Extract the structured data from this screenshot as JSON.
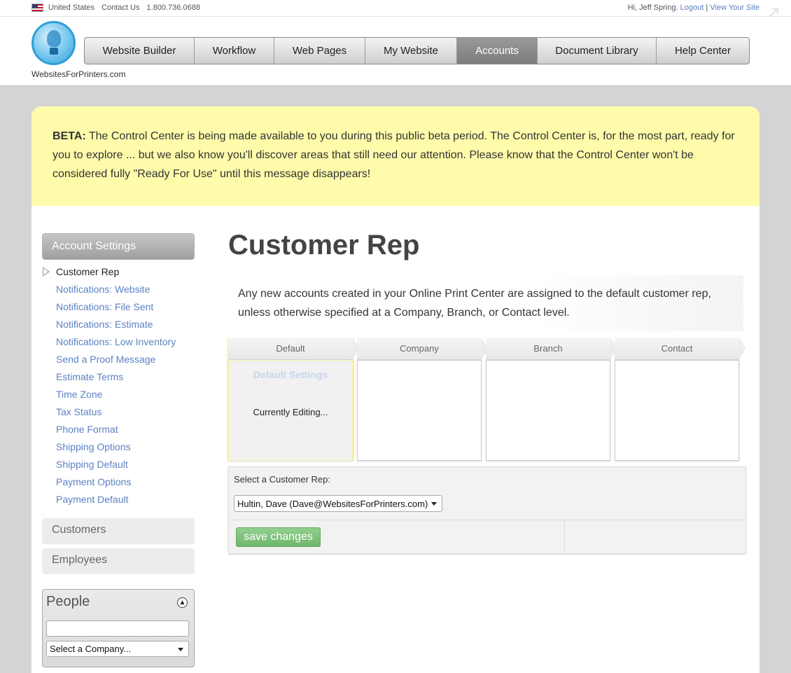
{
  "topbar": {
    "country": "United States",
    "contact_label": "Contact Us",
    "phone": "1.800.736.0688",
    "greeting": "Hi, Jeff Spring.",
    "logout": "Logout",
    "separator": "|",
    "view_site": "View Your Site"
  },
  "brand": {
    "name": "WebsitesForPrinters.com"
  },
  "nav": {
    "items": [
      {
        "label": "Website Builder"
      },
      {
        "label": "Workflow"
      },
      {
        "label": "Web Pages"
      },
      {
        "label": "My Website"
      },
      {
        "label": "Accounts",
        "active": true
      },
      {
        "label": "Document Library"
      },
      {
        "label": "Help Center"
      }
    ]
  },
  "beta": {
    "prefix": "BETA:",
    "message": "The Control Center is being made available to you during this public beta period. The Control Center is, for the most part, ready for you to explore ... but we also know you'll discover areas that still need our attention. Please know that the Control Center won't be considered fully \"Ready For Use\" until this message disappears!"
  },
  "sidebar": {
    "heading": "Account Settings",
    "items": [
      {
        "label": "Customer Rep",
        "current": true
      },
      {
        "label": "Notifications: Website"
      },
      {
        "label": "Notifications: File Sent"
      },
      {
        "label": "Notifications: Estimate"
      },
      {
        "label": "Notifications: Low Inventory"
      },
      {
        "label": "Send a Proof Message"
      },
      {
        "label": "Estimate Terms"
      },
      {
        "label": "Time Zone"
      },
      {
        "label": "Tax Status"
      },
      {
        "label": "Phone Format"
      },
      {
        "label": "Shipping Options"
      },
      {
        "label": "Shipping Default"
      },
      {
        "label": "Payment Options"
      },
      {
        "label": "Payment Default"
      }
    ],
    "customers": "Customers",
    "employees": "Employees",
    "people": {
      "title": "People",
      "search_value": "",
      "company_select": "Select a Company..."
    }
  },
  "main": {
    "title": "Customer Rep",
    "intro": "Any new accounts created in your Online Print Center are assigned to the default customer rep, unless otherwise specified at a Company, Branch, or Contact level.",
    "steps": [
      {
        "label": "Default",
        "subtitle": "Default Settings",
        "status": "Currently Editing..."
      },
      {
        "label": "Company"
      },
      {
        "label": "Branch"
      },
      {
        "label": "Contact"
      }
    ],
    "rep_label": "Select a Customer Rep:",
    "rep_value": "Hultin, Dave (Dave@WebsitesForPrinters.com)",
    "save_label": "save changes"
  },
  "colors": {
    "link": "#5b82c2",
    "beta_bg": "#fefcab",
    "save_green": "#7dc079",
    "nav_active": "#8a8a8a"
  }
}
